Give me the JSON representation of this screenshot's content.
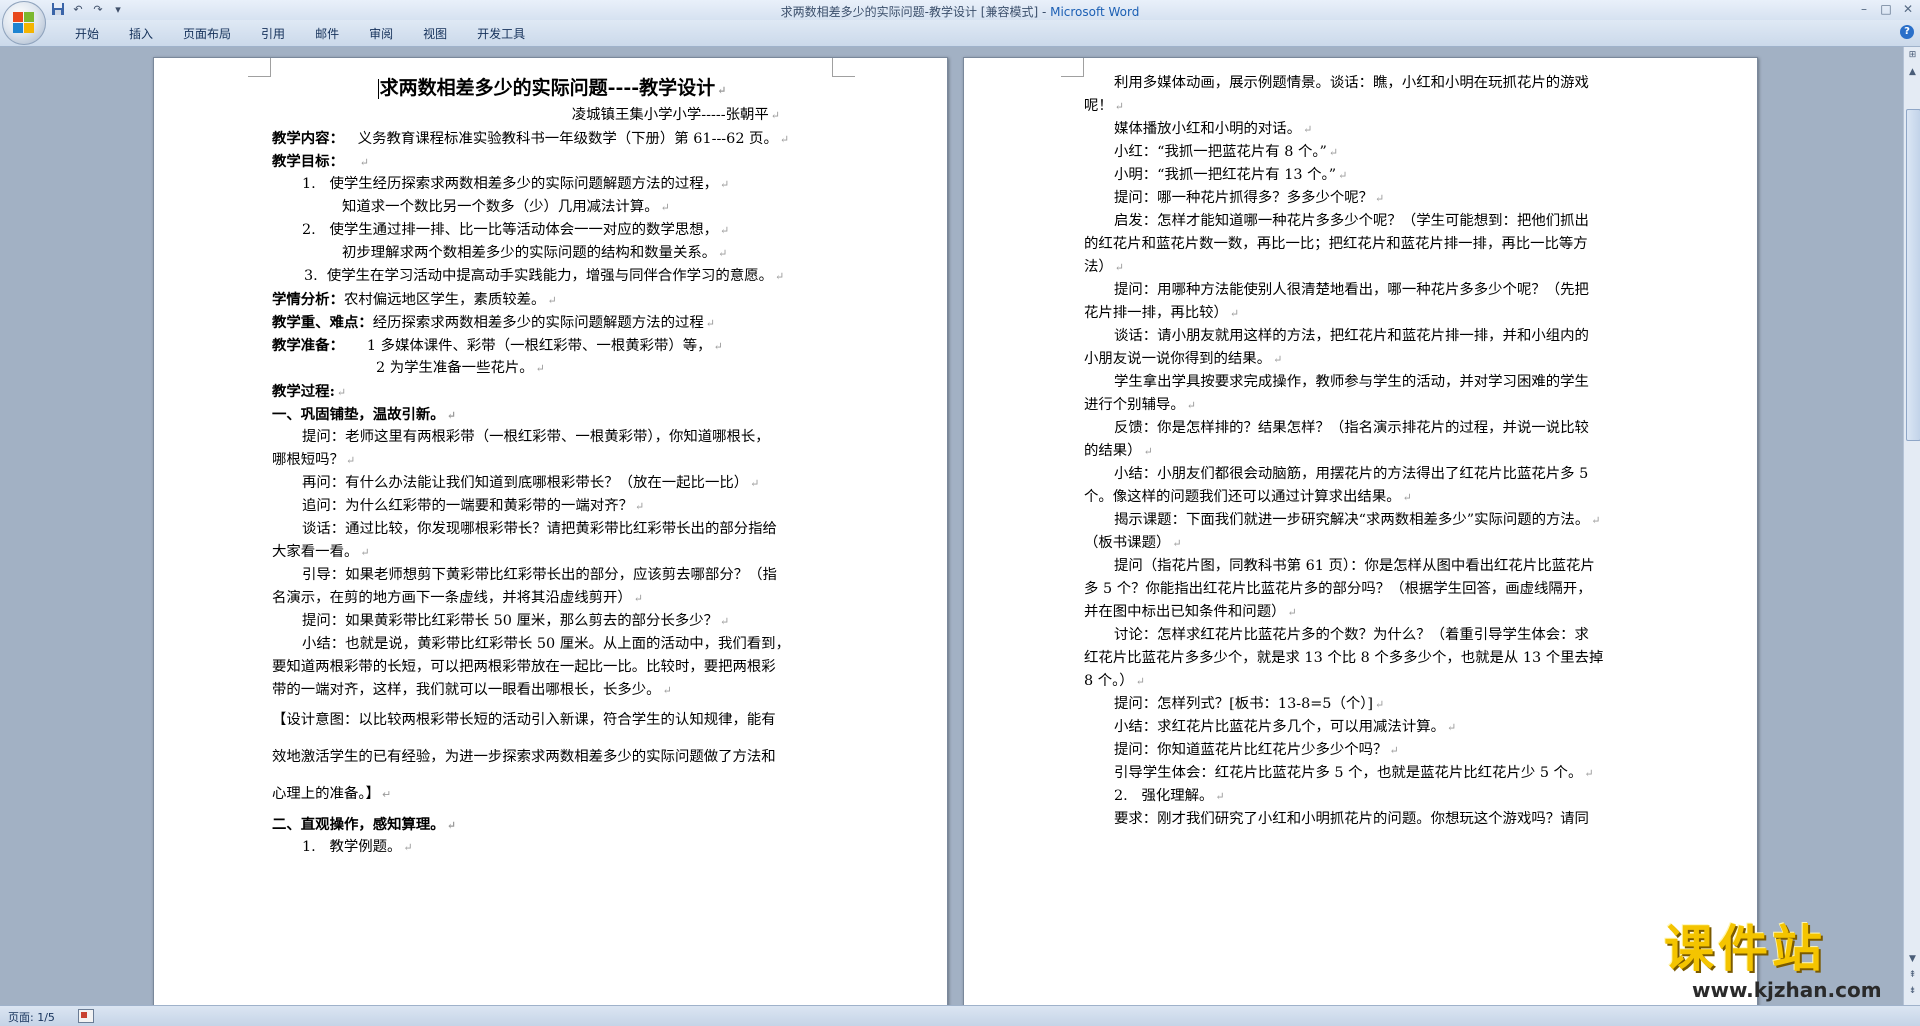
{
  "titlebar": {
    "title": "求两数相差多少的实际问题-教学设计 [兼容模式] - ",
    "app_name": "Microsoft Word"
  },
  "ribbon": {
    "tabs": [
      "开始",
      "插入",
      "页面布局",
      "引用",
      "邮件",
      "审阅",
      "视图",
      "开发工具"
    ]
  },
  "page1": {
    "title": "求两数相差多少的实际问题----教学设计",
    "author": "凌城镇王集小学小学-----张朝平",
    "content_label": "教学内容：",
    "content_text": "义务教育课程标准实验教科书一年级数学（下册）第 61---62 页。",
    "goals_label": "教学目标：",
    "goal1_a": "1.   使学生经历探索求两数相差多少的实际问题解题方法的过程，",
    "goal1_b": "知道求一个数比另一个数多（少）几用减法计算。",
    "goal2_a": "2.   使学生通过排一排、比一比等活动体会一一对应的数学思想，",
    "goal2_b": "初步理解求两个数相差多少的实际问题的结构和数量关系。",
    "goal3": "3.  使学生在学习活动中提高动手实践能力，增强与同伴合作学习的意愿。",
    "analysis_label": "学情分析：",
    "analysis_text": "农村偏远地区学生，素质较差。",
    "key_label": "教学重、难点：",
    "key_text": "经历探索求两数相差多少的实际问题解题方法的过程",
    "prep_label": "教学准备：",
    "prep1": "1 多媒体课件、彩带（一根红彩带、一根黄彩带）等，",
    "prep2": "2 为学生准备一些花片。",
    "process_label": "教学过程:",
    "sec1": "一、巩固铺垫，温故引新。",
    "l1": "提问：老师这里有两根彩带（一根红彩带、一根黄彩带），你知道哪根长，",
    "l2": "哪根短吗？",
    "l3": "再问：有什么办法能让我们知道到底哪根彩带长？（放在一起比一比）",
    "l4": "追问：为什么红彩带的一端要和黄彩带的一端对齐？",
    "l5": "谈话：通过比较，你发现哪根彩带长？请把黄彩带比红彩带长出的部分指给",
    "l6": "大家看一看。",
    "l7": "引导：如果老师想剪下黄彩带比红彩带长出的部分，应该剪去哪部分？（指",
    "l8": "名演示，在剪的地方画下一条虚线，并将其沿虚线剪开）",
    "l9": "提问：如果黄彩带比红彩带长 50 厘米，那么剪去的部分长多少？",
    "l10": "小结：也就是说，黄彩带比红彩带长 50 厘米。从上面的活动中，我们看到，",
    "l11": "要知道两根彩带的长短，可以把两根彩带放在一起比一比。比较时，要把两根彩",
    "l12": "带的一端对齐，这样，我们就可以一眼看出哪根长，长多少。",
    "d1": "【设计意图：以比较两根彩带长短的活动引入新课，符合学生的认知规律，能有",
    "d2": "效地激活学生的已有经验，为进一步探索求两数相差多少的实际问题做了方法和",
    "d3": "心理上的准备。】",
    "sec2": "二、直观操作，感知算理。",
    "sec2_1": "1.   教学例题。"
  },
  "page2": {
    "lines": [
      "利用多媒体动画，展示例题情景。谈话：瞧，小红和小明在玩抓花片的游戏",
      "呢！",
      "媒体播放小红和小明的对话。",
      "小红：“我抓一把蓝花片有 8 个。”",
      "小明：“我抓一把红花片有 13 个。”",
      "提问：哪一种花片抓得多？多多少个呢？",
      "启发：怎样才能知道哪一种花片多多少个呢？（学生可能想到：把他们抓出",
      "的红花片和蓝花片数一数，再比一比；把红花片和蓝花片排一排，再比一比等方",
      "法）",
      "提问：用哪种方法能使别人很清楚地看出，哪一种花片多多少个呢？（先把",
      "花片排一排，再比较）",
      "谈话：请小朋友就用这样的方法，把红花片和蓝花片排一排，并和小组内的",
      "小朋友说一说你得到的结果。",
      "学生拿出学具按要求完成操作，教师参与学生的活动，并对学习困难的学生",
      "进行个别辅导。",
      "反馈：你是怎样排的？结果怎样？（指名演示排花片的过程，并说一说比较",
      "的结果）",
      "小结：小朋友们都很会动脑筋，用摆花片的方法得出了红花片比蓝花片多 5",
      "个。像这样的问题我们还可以通过计算求出结果。",
      "揭示课题：下面我们就进一步研究解决“求两数相差多少”实际问题的方法。",
      "（板书课题）",
      "提问（指花片图，同教科书第 61 页）：你是怎样从图中看出红花片比蓝花片",
      "多 5 个？你能指出红花片比蓝花片多的部分吗？（根据学生回答，画虚线隔开，",
      "并在图中标出已知条件和问题）",
      "讨论：怎样求红花片比蓝花片多的个数？为什么？（着重引导学生体会：求",
      "红花片比蓝花片多多少个，就是求 13 个比 8 个多多少个，也就是从 13 个里去掉",
      "8 个。）",
      "提问：怎样列式？[板书：13-8=5（个）]",
      "小结：求红花片比蓝花片多几个，可以用减法计算。",
      "提问：你知道蓝花片比红花片少多少个吗？",
      "引导学生体会：红花片比蓝花片多 5 个，也就是蓝花片比红花片少 5 个。",
      "2.   强化理解。",
      "要求：刚才我们研究了小红和小明抓花片的问题。你想玩这个游戏吗？请同"
    ]
  },
  "statusbar": {
    "page_indicator": "页面: 1/5"
  },
  "watermark": {
    "title": "课件站",
    "url": "www.kjzhan.com"
  },
  "colors": {
    "app_name": "#1b5fb4",
    "ribbon_bg": "#cbd9ea",
    "doc_bg": "#a2b1c4",
    "watermark": "#f4c400"
  },
  "icons": [
    "office-button-icon",
    "save-icon",
    "undo-icon",
    "redo-icon",
    "minimize-icon",
    "maximize-icon",
    "close-icon",
    "help-icon",
    "macro-icon"
  ]
}
